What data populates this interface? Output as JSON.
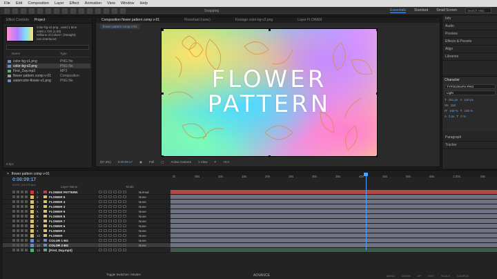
{
  "menu": [
    "File",
    "Edit",
    "Composition",
    "Layer",
    "Effect",
    "Animation",
    "View",
    "Window",
    "Help"
  ],
  "toolbar": {
    "snapping": "Snapping"
  },
  "workspaces": {
    "items": [
      "Essentials",
      "Standard",
      "Small Screen"
    ],
    "active": "Essentials",
    "search_placeholder": "Search Help"
  },
  "project": {
    "tab_label": "Project",
    "other_tab": "Effect Controls",
    "selected_name": "color-bg-v2.png",
    "info_lines": [
      "color-bg-v2.png , used 1 time",
      "1280 x 720 (1.00)",
      "Millions of Colors+ (Straight)",
      "non-interlaced"
    ],
    "columns": [
      "Name",
      "Type"
    ],
    "items": [
      {
        "name": "color-bg-v1.png",
        "type": "PNG file"
      },
      {
        "name": "color-bg-v2.png",
        "type": "PNG file"
      },
      {
        "name": "First_Day.mp3",
        "type": "MP3"
      },
      {
        "name": "flower pattern comp v-01",
        "type": "Composition"
      },
      {
        "name": "watercolor-flower-v1.png",
        "type": "PNG file"
      }
    ],
    "footer": "8 bpc"
  },
  "composition": {
    "tabs": [
      "Composition flower pattern comp v-01",
      "Flowchart (none)",
      "Footage color-bg-v2.png",
      "Layer FLOWER"
    ],
    "subtab": "flower pattern comp v-01",
    "title_line1": "FLOWER",
    "title_line2": "PATTERN",
    "controls": {
      "zoom": "(57.2%)",
      "timecode": "0:00:09:17",
      "resolution": "Full",
      "camera": "Active Camera",
      "views": "1 View",
      "exposure": "+0.0"
    }
  },
  "right_panels": {
    "items": [
      "Info",
      "Audio",
      "Preview",
      "Effects & Presets",
      "Align",
      "Libraries"
    ],
    "character": {
      "title": "Character",
      "font": "TYPOGRAPH PRO",
      "style": "Light",
      "size": "151 px",
      "leading": "120 px",
      "tracking": "150",
      "scale_v": "100 %",
      "scale_h": "100 %",
      "baseline": "0 px",
      "tsume": "0 %"
    },
    "paragraph": "Paragraph",
    "tracker": "Tracker"
  },
  "timeline": {
    "comp_name": "flower pattern comp v-01",
    "timecode": "0:00:09:17",
    "timecode_sub": "00237 (23.976 fps)",
    "ruler": [
      "0f",
      "05s",
      "10s",
      "15s",
      "20s",
      "25s",
      "30s",
      "35s",
      "40s",
      "45s",
      "50s",
      "55s",
      "1:00s",
      "05s"
    ],
    "columns": {
      "layer_name": "Layer Name",
      "mode": "Mode"
    },
    "layers": [
      {
        "num": "1",
        "name": "FLOWER PATTERN",
        "mode": "Normal",
        "label": "#c43c3c"
      },
      {
        "num": "2",
        "name": "FLOWER 5",
        "mode": "None",
        "label": "#d8c26b"
      },
      {
        "num": "3",
        "name": "FLOWER 4",
        "mode": "None",
        "label": "#d8c26b"
      },
      {
        "num": "4",
        "name": "FLOWER 3",
        "mode": "None",
        "label": "#d8c26b"
      },
      {
        "num": "5",
        "name": "FLOWER 9",
        "mode": "None",
        "label": "#d8c26b"
      },
      {
        "num": "6",
        "name": "FLOWER 8",
        "mode": "None",
        "label": "#d8c26b"
      },
      {
        "num": "7",
        "name": "FLOWER 7",
        "mode": "None",
        "label": "#d8c26b"
      },
      {
        "num": "8",
        "name": "FLOWER 6",
        "mode": "None",
        "label": "#d8c26b"
      },
      {
        "num": "9",
        "name": "FLOWER 2",
        "mode": "None",
        "label": "#d8c26b"
      },
      {
        "num": "10",
        "name": "FLOWER",
        "mode": "None",
        "label": "#d8c26b"
      },
      {
        "num": "11",
        "name": "COLOR 1 BG",
        "mode": "None",
        "label": "#6a8cc8"
      },
      {
        "num": "12",
        "name": "COLOR 2 BG",
        "mode": "None",
        "label": "#6a8cc8"
      },
      {
        "num": "13",
        "name": "[First_Day.mp3]",
        "mode": "",
        "label": "#4fb07a"
      }
    ],
    "footer": "Toggle Switches / Modes"
  },
  "monitor": {
    "brand": "ADVANCE",
    "buttons": [
      "MENU",
      "DOWN",
      "UP",
      "EXIT",
      "SCALE",
      "SOURCE"
    ]
  },
  "colors": {
    "accent": "#4aa3ff",
    "panel": "#232323",
    "layer_bar": "#6e7281",
    "first_layer_bar": "#b04a45"
  }
}
